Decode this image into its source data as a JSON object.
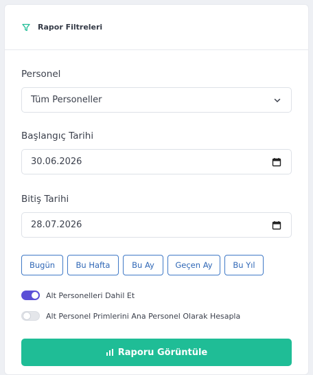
{
  "header": {
    "title": "Rapor Filtreleri",
    "icon": "filter-icon",
    "accent": "#1fbd96"
  },
  "personel": {
    "label": "Personel",
    "selected": "Tüm Personeller"
  },
  "start_date": {
    "label": "Başlangıç Tarihi",
    "value": "30.06.2026"
  },
  "end_date": {
    "label": "Bitiş Tarihi",
    "value": "28.07.2026"
  },
  "quick_ranges": [
    "Bugün",
    "Bu Hafta",
    "Bu Ay",
    "Geçen Ay",
    "Bu Yıl"
  ],
  "toggles": {
    "include_sub": {
      "label": "Alt Personelleri Dahil Et",
      "checked": true
    },
    "sub_bonus": {
      "label": "Alt Personel Primlerini Ana Personel Olarak Hesapla",
      "checked": false
    }
  },
  "submit": {
    "label": "Raporu Görüntüle",
    "icon": "chart-icon"
  },
  "colors": {
    "primary_outline": "#3e78c6",
    "toggle_on": "#5b4fd6",
    "submit_bg": "#1fbd96"
  }
}
